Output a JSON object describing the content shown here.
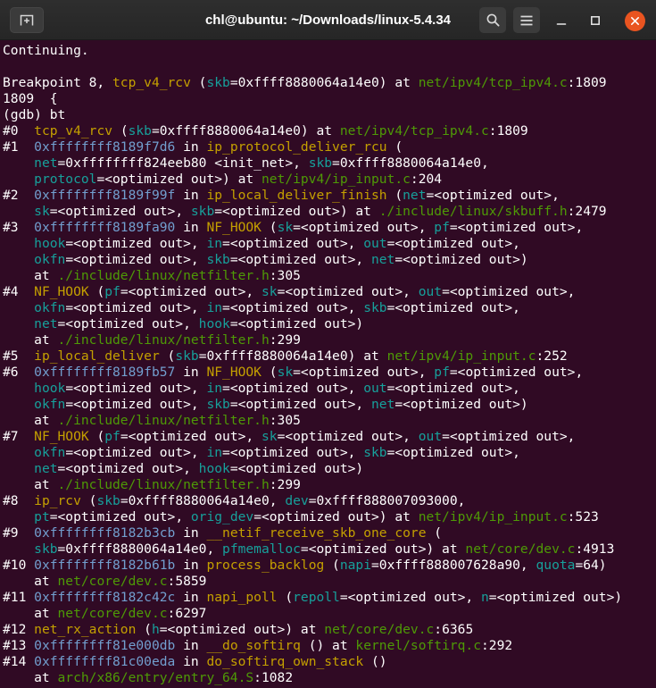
{
  "window": {
    "title": "chl@ubuntu: ~/Downloads/linux-5.4.34",
    "controls": [
      {
        "name": "new-tab-button",
        "icon": "new-tab-icon"
      },
      {
        "name": "search-button",
        "icon": "search-icon"
      },
      {
        "name": "menu-button",
        "icon": "hamburger-icon"
      },
      {
        "name": "minimize-button",
        "icon": "minimize-icon"
      },
      {
        "name": "maximize-button",
        "icon": "maximize-icon"
      },
      {
        "name": "close-button",
        "icon": "close-icon"
      }
    ]
  },
  "terminal": {
    "palette": {
      "background": "#300a24",
      "foreground": "#ffffff",
      "function_name": "#c4a000",
      "variable_name": "#17a09b",
      "file_path": "#4e9a06",
      "address": "#729fcf",
      "titlebar": "#2a2a2a",
      "close_button": "#e95420"
    },
    "lines": [
      [
        [
          "w",
          "Continuing."
        ]
      ],
      [],
      [
        [
          "w",
          "Breakpoint 8, "
        ],
        [
          "y",
          "tcp_v4_rcv"
        ],
        [
          "w",
          " ("
        ],
        [
          "c",
          "skb"
        ],
        [
          "w",
          "=0xffff8880064a14e0) at "
        ],
        [
          "g",
          "net/ipv4/tcp_ipv4.c"
        ],
        [
          "w",
          ":1809"
        ]
      ],
      [
        [
          "w",
          "1809  {"
        ]
      ],
      [
        [
          "w",
          "(gdb) bt"
        ]
      ],
      [
        [
          "w",
          "#0  "
        ],
        [
          "y",
          "tcp_v4_rcv"
        ],
        [
          "w",
          " ("
        ],
        [
          "c",
          "skb"
        ],
        [
          "w",
          "=0xffff8880064a14e0) at "
        ],
        [
          "g",
          "net/ipv4/tcp_ipv4.c"
        ],
        [
          "w",
          ":1809"
        ]
      ],
      [
        [
          "w",
          "#1  "
        ],
        [
          "b",
          "0xffffffff8189f7d6"
        ],
        [
          "w",
          " in "
        ],
        [
          "y",
          "ip_protocol_deliver_rcu"
        ],
        [
          "w",
          " ("
        ]
      ],
      [
        [
          "w",
          "    "
        ],
        [
          "c",
          "net"
        ],
        [
          "w",
          "=0xffffffff824eeb80 <init_net>, "
        ],
        [
          "c",
          "skb"
        ],
        [
          "w",
          "=0xffff8880064a14e0,"
        ]
      ],
      [
        [
          "w",
          "    "
        ],
        [
          "c",
          "protocol"
        ],
        [
          "w",
          "=<optimized out>) at "
        ],
        [
          "g",
          "net/ipv4/ip_input.c"
        ],
        [
          "w",
          ":204"
        ]
      ],
      [
        [
          "w",
          "#2  "
        ],
        [
          "b",
          "0xffffffff8189f99f"
        ],
        [
          "w",
          " in "
        ],
        [
          "y",
          "ip_local_deliver_finish"
        ],
        [
          "w",
          " ("
        ],
        [
          "c",
          "net"
        ],
        [
          "w",
          "=<optimized out>,"
        ]
      ],
      [
        [
          "w",
          "    "
        ],
        [
          "c",
          "sk"
        ],
        [
          "w",
          "=<optimized out>, "
        ],
        [
          "c",
          "skb"
        ],
        [
          "w",
          "=<optimized out>) at "
        ],
        [
          "g",
          "./include/linux/skbuff.h"
        ],
        [
          "w",
          ":2479"
        ]
      ],
      [
        [
          "w",
          "#3  "
        ],
        [
          "b",
          "0xffffffff8189fa90"
        ],
        [
          "w",
          " in "
        ],
        [
          "y",
          "NF_HOOK"
        ],
        [
          "w",
          " ("
        ],
        [
          "c",
          "sk"
        ],
        [
          "w",
          "=<optimized out>, "
        ],
        [
          "c",
          "pf"
        ],
        [
          "w",
          "=<optimized out>,"
        ]
      ],
      [
        [
          "w",
          "    "
        ],
        [
          "c",
          "hook"
        ],
        [
          "w",
          "=<optimized out>, "
        ],
        [
          "c",
          "in"
        ],
        [
          "w",
          "=<optimized out>, "
        ],
        [
          "c",
          "out"
        ],
        [
          "w",
          "=<optimized out>,"
        ]
      ],
      [
        [
          "w",
          "    "
        ],
        [
          "c",
          "okfn"
        ],
        [
          "w",
          "=<optimized out>, "
        ],
        [
          "c",
          "skb"
        ],
        [
          "w",
          "=<optimized out>, "
        ],
        [
          "c",
          "net"
        ],
        [
          "w",
          "=<optimized out>)"
        ]
      ],
      [
        [
          "w",
          "    at "
        ],
        [
          "g",
          "./include/linux/netfilter.h"
        ],
        [
          "w",
          ":305"
        ]
      ],
      [
        [
          "w",
          "#4  "
        ],
        [
          "y",
          "NF_HOOK"
        ],
        [
          "w",
          " ("
        ],
        [
          "c",
          "pf"
        ],
        [
          "w",
          "=<optimized out>, "
        ],
        [
          "c",
          "sk"
        ],
        [
          "w",
          "=<optimized out>, "
        ],
        [
          "c",
          "out"
        ],
        [
          "w",
          "=<optimized out>,"
        ]
      ],
      [
        [
          "w",
          "    "
        ],
        [
          "c",
          "okfn"
        ],
        [
          "w",
          "=<optimized out>, "
        ],
        [
          "c",
          "in"
        ],
        [
          "w",
          "=<optimized out>, "
        ],
        [
          "c",
          "skb"
        ],
        [
          "w",
          "=<optimized out>,"
        ]
      ],
      [
        [
          "w",
          "    "
        ],
        [
          "c",
          "net"
        ],
        [
          "w",
          "=<optimized out>, "
        ],
        [
          "c",
          "hook"
        ],
        [
          "w",
          "=<optimized out>)"
        ]
      ],
      [
        [
          "w",
          "    at "
        ],
        [
          "g",
          "./include/linux/netfilter.h"
        ],
        [
          "w",
          ":299"
        ]
      ],
      [
        [
          "w",
          "#5  "
        ],
        [
          "y",
          "ip_local_deliver"
        ],
        [
          "w",
          " ("
        ],
        [
          "c",
          "skb"
        ],
        [
          "w",
          "=0xffff8880064a14e0) at "
        ],
        [
          "g",
          "net/ipv4/ip_input.c"
        ],
        [
          "w",
          ":252"
        ]
      ],
      [
        [
          "w",
          "#6  "
        ],
        [
          "b",
          "0xffffffff8189fb57"
        ],
        [
          "w",
          " in "
        ],
        [
          "y",
          "NF_HOOK"
        ],
        [
          "w",
          " ("
        ],
        [
          "c",
          "sk"
        ],
        [
          "w",
          "=<optimized out>, "
        ],
        [
          "c",
          "pf"
        ],
        [
          "w",
          "=<optimized out>,"
        ]
      ],
      [
        [
          "w",
          "    "
        ],
        [
          "c",
          "hook"
        ],
        [
          "w",
          "=<optimized out>, "
        ],
        [
          "c",
          "in"
        ],
        [
          "w",
          "=<optimized out>, "
        ],
        [
          "c",
          "out"
        ],
        [
          "w",
          "=<optimized out>,"
        ]
      ],
      [
        [
          "w",
          "    "
        ],
        [
          "c",
          "okfn"
        ],
        [
          "w",
          "=<optimized out>, "
        ],
        [
          "c",
          "skb"
        ],
        [
          "w",
          "=<optimized out>, "
        ],
        [
          "c",
          "net"
        ],
        [
          "w",
          "=<optimized out>)"
        ]
      ],
      [
        [
          "w",
          "    at "
        ],
        [
          "g",
          "./include/linux/netfilter.h"
        ],
        [
          "w",
          ":305"
        ]
      ],
      [
        [
          "w",
          "#7  "
        ],
        [
          "y",
          "NF_HOOK"
        ],
        [
          "w",
          " ("
        ],
        [
          "c",
          "pf"
        ],
        [
          "w",
          "=<optimized out>, "
        ],
        [
          "c",
          "sk"
        ],
        [
          "w",
          "=<optimized out>, "
        ],
        [
          "c",
          "out"
        ],
        [
          "w",
          "=<optimized out>,"
        ]
      ],
      [
        [
          "w",
          "    "
        ],
        [
          "c",
          "okfn"
        ],
        [
          "w",
          "=<optimized out>, "
        ],
        [
          "c",
          "in"
        ],
        [
          "w",
          "=<optimized out>, "
        ],
        [
          "c",
          "skb"
        ],
        [
          "w",
          "=<optimized out>,"
        ]
      ],
      [
        [
          "w",
          "    "
        ],
        [
          "c",
          "net"
        ],
        [
          "w",
          "=<optimized out>, "
        ],
        [
          "c",
          "hook"
        ],
        [
          "w",
          "=<optimized out>)"
        ]
      ],
      [
        [
          "w",
          "    at "
        ],
        [
          "g",
          "./include/linux/netfilter.h"
        ],
        [
          "w",
          ":299"
        ]
      ],
      [
        [
          "w",
          "#8  "
        ],
        [
          "y",
          "ip_rcv"
        ],
        [
          "w",
          " ("
        ],
        [
          "c",
          "skb"
        ],
        [
          "w",
          "=0xffff8880064a14e0, "
        ],
        [
          "c",
          "dev"
        ],
        [
          "w",
          "=0xffff888007093000,"
        ]
      ],
      [
        [
          "w",
          "    "
        ],
        [
          "c",
          "pt"
        ],
        [
          "w",
          "=<optimized out>, "
        ],
        [
          "c",
          "orig_dev"
        ],
        [
          "w",
          "=<optimized out>) at "
        ],
        [
          "g",
          "net/ipv4/ip_input.c"
        ],
        [
          "w",
          ":523"
        ]
      ],
      [
        [
          "w",
          "#9  "
        ],
        [
          "b",
          "0xffffffff8182b3cb"
        ],
        [
          "w",
          " in "
        ],
        [
          "y",
          "__netif_receive_skb_one_core"
        ],
        [
          "w",
          " ("
        ]
      ],
      [
        [
          "w",
          "    "
        ],
        [
          "c",
          "skb"
        ],
        [
          "w",
          "=0xffff8880064a14e0, "
        ],
        [
          "c",
          "pfmemalloc"
        ],
        [
          "w",
          "=<optimized out>) at "
        ],
        [
          "g",
          "net/core/dev.c"
        ],
        [
          "w",
          ":4913"
        ]
      ],
      [
        [
          "w",
          "#10 "
        ],
        [
          "b",
          "0xffffffff8182b61b"
        ],
        [
          "w",
          " in "
        ],
        [
          "y",
          "process_backlog"
        ],
        [
          "w",
          " ("
        ],
        [
          "c",
          "napi"
        ],
        [
          "w",
          "=0xffff888007628a90, "
        ],
        [
          "c",
          "quota"
        ],
        [
          "w",
          "=64)"
        ]
      ],
      [
        [
          "w",
          "    at "
        ],
        [
          "g",
          "net/core/dev.c"
        ],
        [
          "w",
          ":5859"
        ]
      ],
      [
        [
          "w",
          "#11 "
        ],
        [
          "b",
          "0xffffffff8182c42c"
        ],
        [
          "w",
          " in "
        ],
        [
          "y",
          "napi_poll"
        ],
        [
          "w",
          " ("
        ],
        [
          "c",
          "repoll"
        ],
        [
          "w",
          "=<optimized out>, "
        ],
        [
          "c",
          "n"
        ],
        [
          "w",
          "=<optimized out>)"
        ]
      ],
      [
        [
          "w",
          "    at "
        ],
        [
          "g",
          "net/core/dev.c"
        ],
        [
          "w",
          ":6297"
        ]
      ],
      [
        [
          "w",
          "#12 "
        ],
        [
          "y",
          "net_rx_action"
        ],
        [
          "w",
          " ("
        ],
        [
          "c",
          "h"
        ],
        [
          "w",
          "=<optimized out>) at "
        ],
        [
          "g",
          "net/core/dev.c"
        ],
        [
          "w",
          ":6365"
        ]
      ],
      [
        [
          "w",
          "#13 "
        ],
        [
          "b",
          "0xffffffff81e000db"
        ],
        [
          "w",
          " in "
        ],
        [
          "y",
          "__do_softirq"
        ],
        [
          "w",
          " () at "
        ],
        [
          "g",
          "kernel/softirq.c"
        ],
        [
          "w",
          ":292"
        ]
      ],
      [
        [
          "w",
          "#14 "
        ],
        [
          "b",
          "0xffffffff81c00eda"
        ],
        [
          "w",
          " in "
        ],
        [
          "y",
          "do_softirq_own_stack"
        ],
        [
          "w",
          " ()"
        ]
      ],
      [
        [
          "w",
          "    at "
        ],
        [
          "g",
          "arch/x86/entry/entry_64.S"
        ],
        [
          "w",
          ":1082"
        ]
      ]
    ]
  }
}
